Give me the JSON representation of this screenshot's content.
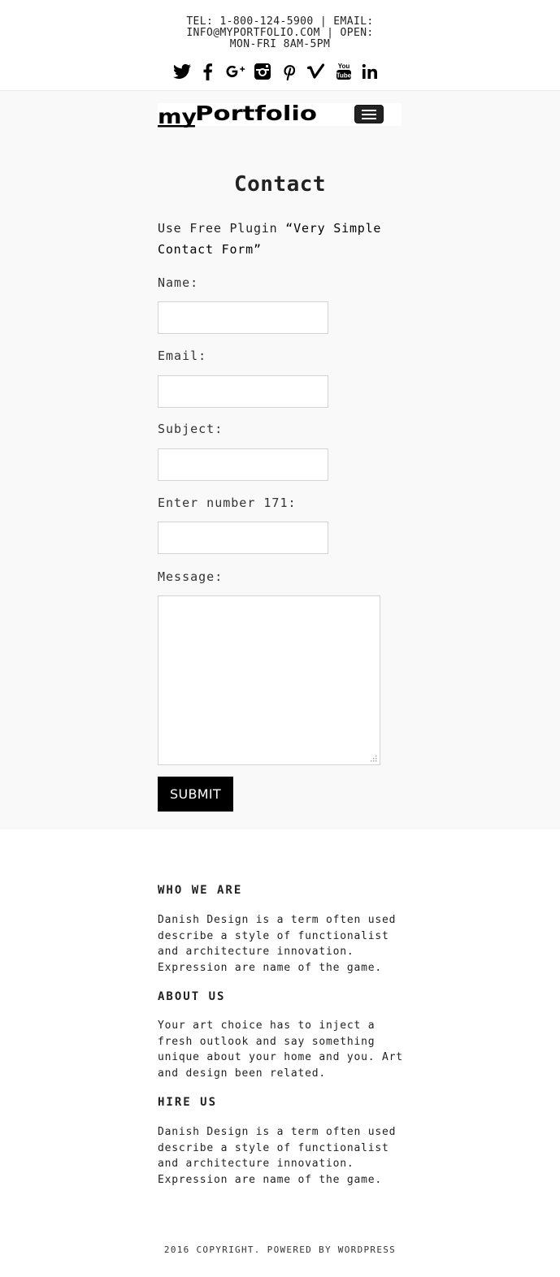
{
  "topbar": {
    "contact_line1": "TEL: 1-800-124-5900 | EMAIL:",
    "contact_line2": "INFO@MYPORTFOLIO.COM | OPEN:",
    "contact_line3": "MON-FRI 8AM-5PM",
    "social_icons": [
      "twitter-icon",
      "facebook-icon",
      "google-plus-icon",
      "instagram-icon",
      "pinterest-icon",
      "vimeo-icon",
      "youtube-icon",
      "linkedin-icon"
    ],
    "youtube_text_top": "You",
    "youtube_text_bottom": "Tube"
  },
  "header": {
    "logo_text_my": "my",
    "logo_text_portfolio": "Portfolio",
    "menu_icon": "hamburger-menu-icon"
  },
  "page": {
    "title": "Contact",
    "intro_line1_prefix": "Use Free Plugin ",
    "intro_line1_quote": "“Very Simple",
    "intro_line2": "Contact Form”"
  },
  "form": {
    "name_label": "Name:",
    "name_value": "",
    "email_label": "Email:",
    "email_value": "",
    "subject_label": "Subject:",
    "subject_value": "",
    "captcha_label": "Enter number 171:",
    "captcha_value": "",
    "message_label": "Message:",
    "message_value": "",
    "submit_label": "SUBMIT"
  },
  "footer": {
    "who_title": "WHO WE ARE",
    "who_text": "Danish Design is a term often used\ndescribe a style of functionalist\nand architecture innovation.\nExpression are name of the game.",
    "about_title": "ABOUT US",
    "about_text": "Your art choice has to inject a\nfresh outlook and say something\nunique about your home and you. Art\nand design been related.",
    "hire_title": "HIRE US",
    "hire_text": "Danish Design is a term often used\ndescribe a style of functionalist\nand architecture innovation.\nExpression are name of the game.",
    "copyright": "2016 COPYRIGHT. POWERED BY WORDPRESS"
  },
  "colors": {
    "background": "#ffffff",
    "content_background": "#f9f9f9",
    "text": "#222222",
    "button": "#000000",
    "input_border": "#d4d4d4"
  }
}
